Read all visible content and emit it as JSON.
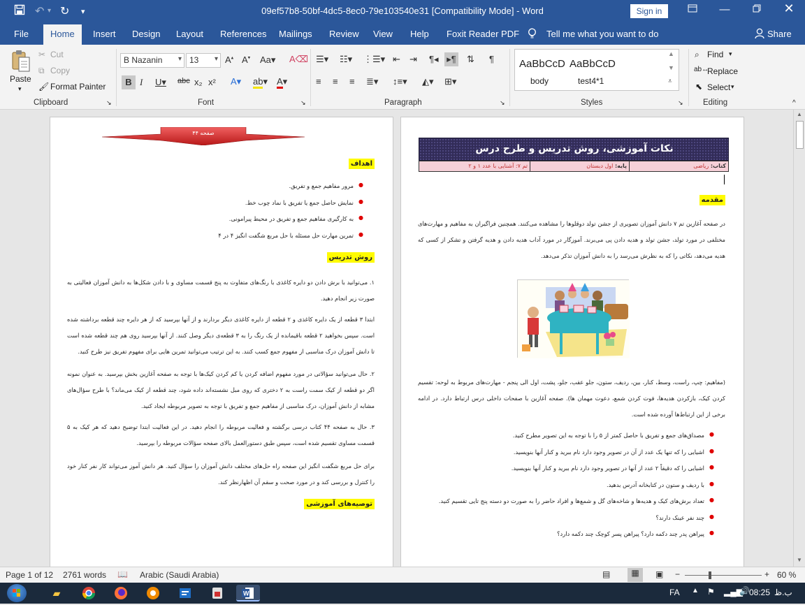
{
  "window": {
    "title": "09ef57b8-50bf-4dc5-8ec0-79e103540e31 [Compatibility Mode]  -  Word",
    "sign_in": "Sign in"
  },
  "tabs": [
    "File",
    "Home",
    "Insert",
    "Design",
    "Layout",
    "References",
    "Mailings",
    "Review",
    "View",
    "Help",
    "Foxit Reader PDF"
  ],
  "tell_me": "Tell me what you want to do",
  "share": "Share",
  "ribbon": {
    "clipboard": {
      "paste": "Paste",
      "cut": "Cut",
      "copy": "Copy",
      "format_painter": "Format Painter",
      "label": "Clipboard"
    },
    "font": {
      "name": "B Nazanin",
      "size": "13",
      "label": "Font"
    },
    "paragraph": {
      "label": "Paragraph"
    },
    "styles": {
      "s1_preview": "AaBbCcD",
      "s1_name": "body",
      "s2_preview": "AaBbCcD",
      "s2_name": "test4*1",
      "label": "Styles"
    },
    "editing": {
      "find": "Find",
      "replace": "Replace",
      "select": "Select",
      "label": "Editing"
    }
  },
  "left_page": {
    "banner": "صفحه ۴۴",
    "h_goals": "اهداف",
    "goals": [
      "مرور مفاهیم جمع و تفریق.",
      "نمایش حاصل جمع یا تفریق با نماد چوب خط.",
      "به کارگیری مفاهیم جمع و تفریق در محیط پیرامونی.",
      "تمرین مهارت حل مسئله با حل مربع شگفت انگیز ۴ در ۴"
    ],
    "h_method": "روش تدریس",
    "p1": "۱. می‌توانید با برش دادن دو دایره کاغذی با رنگ‌های متفاوت به پنج قسمت مساوی و با دادن شکل‌ها به دانش آموزان فعالیتی به صورت زیر انجام دهید.",
    "p2": "ابتدا ۳ قطعه از یک دایره کاغذی و ۲ قطعه از دایره کاغذی دیگر بردارند و از آنها بپرسید که از هر دایره چند قطعه برداشته شده است. سپس بخواهید ۲ قطعه باقیمانده از یک رنگ را به ۳ قطعه‌ی دیگر وصل کنند. از آنها بپرسید روی هم چند قطعه شده است تا دانش آموزان درک مناسبی از مفهوم جمع کسب کنند. به این ترتیب می‌توانید تمرین هایی برای مفهوم تفریق نیز طرح کنید.",
    "p3": "۲. حال می‌توانید سؤالاتی در مورد مفهوم اضافه کردن یا کم کردن کیک‌ها با توجه به صفحه آغازین بخش بپرسید. به عنوان نمونه اگر دو قطعه از کیک سمت راست به ۲ دختری که روی مبل نشسته‌اند داده شود، چند قطعه از کیک می‌ماند؟ با طرح سؤال‌های مشابه از دانش آموزان، درک مناسبی از مفاهیم جمع و تفریق با توجه به تصویر مربوطه ایجاد کنید.",
    "p4": "۳. حال به صفحه ۴۴ کتاب درسی برگشته و فعالیت مربوطه را انجام دهید. در این فعالیت ابتدا توضیح دهید که هر کیک به ۵ قسمت مساوی تقسیم شده است، سپس طبق دستورالعمل بالای صفحه سؤالات مربوطه را بپرسید.",
    "p5": "برای حل مربع شگفت انگیز این صفحه راه حل‌های مختلف دانش آموزان را سؤال کنید. هر دانش آموز می‌تواند کار نفر کنار خود را کنترل و بررسی کند و در مورد صحت و سقم آن اظهارنظر کند.",
    "h_tips": "توصیه‌های آموزشی"
  },
  "right_page": {
    "header_title": "نکات آموزشی، روش تدریس و طرح درس",
    "book_label": "کتاب:",
    "book": "ریاضی",
    "grade_label": "پایه:",
    "grade": "اول دبستان",
    "theme": "تم ۷: آشنایی با عدد ۱ و ۲",
    "h_intro": "مقدمه",
    "intro": "در صفحه آغازین تم ۷ دانش آموزان تصویری از جشن تولد دوقلوها را مشاهده می‌کنند. همچنین فراگیران به مفاهیم و مهارت‌های مختلفی در مورد تولد، جشن تولد و هدیه دادن پی می‌برند. آموزگار در مورد آداب هدیه دادن و هدیه گرفتن و تشکر از کسی که هدیه می‌دهد، نکاتی را که به نظرش می‌رسد را به دانش آموزان تذکر می‌دهد.",
    "concepts": "(مفاهیم: چپ، راست، وسط، کنار، بین، ردیف، ستون، جلو عقب، جلو، پشت، اول الی پنجم - مهارت‌های مربوط به لوحه: تقسیم کردن کیک، بازکردن هدیه‌ها، فوت کردن شمع، دعوت مهمان ها). صفحه آغازین با صفحات داخلی درس ارتباط دارد. در ادامه برخی از این ارتباط‌ها آورده شده است.",
    "items": [
      "مصداق‌های جمع و تفریق با حاصل کمتر از ۵ را با توجه به این تصویر مطرح کنید.",
      "اشیایی را که تنها یک عدد از آن در تصویر وجود دارد نام ببرید و کنار آنها بنویسید.",
      "اشیایی را که دقیقاً ۲ عدد از آنها در تصویر وجود دارد نام ببرید و کنار آنها بنویسید.",
      "با ردیف و ستون در کتابخانه آدرس بدهید.",
      "تعداد برش‌های کیک و هدیه‌ها و شاخه‌های گل و شمع‌ها و افراد حاضر را به صورت دو دسته پنج تایی تقسیم کنید.",
      "چند نفر عینک دارند؟",
      "پیراهن پدر چند دکمه دارد؟ پیراهن پسر کوچک چند دکمه دارد؟"
    ]
  },
  "status": {
    "page": "Page 1 of 12",
    "words": "2761 words",
    "language": "Arabic (Saudi Arabia)",
    "zoom": "60 %"
  },
  "taskbar": {
    "lang": "FA",
    "time": "08:25",
    "ampm": "ب.ظ"
  }
}
